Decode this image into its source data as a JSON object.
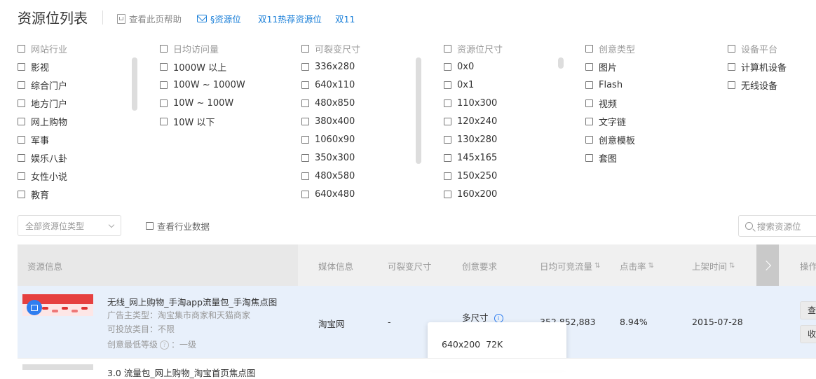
{
  "header": {
    "title": "资源位列表",
    "help_link": "查看此页帮助",
    "link_resources": "§资源位",
    "link_double11_recommend": "双11热荐资源位",
    "link_double11": "双11"
  },
  "filters": {
    "industry": {
      "label": "网站行业",
      "items": [
        "影视",
        "综合门户",
        "地方门户",
        "网上购物",
        "军事",
        "娱乐八卦",
        "女性小说",
        "教育"
      ]
    },
    "daily_visits": {
      "label": "日均访问量",
      "items": [
        "1000W 以上",
        "100W ~ 1000W",
        "10W ~ 100W",
        "10W 以下"
      ]
    },
    "splittable_size": {
      "label": "可裂变尺寸",
      "items": [
        "336x280",
        "640x110",
        "480x850",
        "380x400",
        "1060x90",
        "350x300",
        "480x580",
        "640x480"
      ]
    },
    "slot_size": {
      "label": "资源位尺寸",
      "items": [
        "0x0",
        "0x1",
        "110x300",
        "120x240",
        "130x280",
        "145x165",
        "150x250",
        "160x200"
      ]
    },
    "creative_type": {
      "label": "创意类型",
      "items": [
        "图片",
        "Flash",
        "视频",
        "文字链",
        "创意模板",
        "套图"
      ]
    },
    "device_platform": {
      "label": "设备平台",
      "items": [
        "计算机设备",
        "无线设备"
      ]
    }
  },
  "toolbar": {
    "type_select": "全部资源位类型",
    "industry_data": "查看行业数据",
    "search_placeholder": "搜索资源位"
  },
  "table": {
    "headers": {
      "info": "资源信息",
      "media": "媒体信息",
      "split_size": "可裂变尺寸",
      "creative_req": "创意要求",
      "daily_traffic": "日均可竞流量",
      "ctr": "点击率",
      "listed_time": "上架时间",
      "ops": "操作"
    },
    "rows": [
      {
        "title": "无线_网上购物_手淘app流量包_手淘焦点图",
        "advertiser": "广告主类型：淘宝集市商家和天猫商家",
        "category": "可投放类目：不限",
        "level_label": "创意最低等级",
        "level_value": "：一级",
        "media": "淘宝网",
        "split_size": "-",
        "creative": "多尺寸",
        "traffic": "352,852,883",
        "ctr": "8.94%",
        "date": "2015-07-28",
        "btn1": "查",
        "btn2": "收"
      }
    ],
    "row2_partial": "3.0 流量包_网上购物_淘宝首页焦点图"
  },
  "popup": {
    "size": "640x200",
    "traffic": "72K"
  },
  "colors": {
    "accent": "#1a7fd8",
    "row_highlight": "#e8f0fb"
  }
}
